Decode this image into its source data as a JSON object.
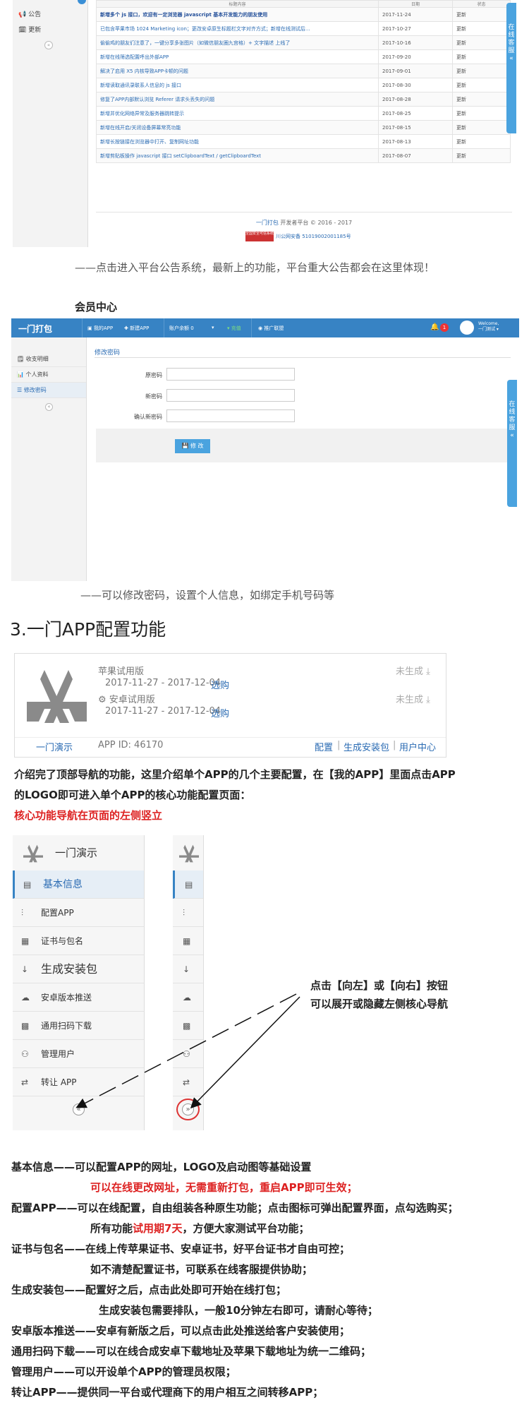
{
  "announce": {
    "sidebar": [
      "公告",
      "更新"
    ],
    "collapse": "«",
    "header_title": "标题内容",
    "header_date": "日期",
    "header_status": "状态",
    "rows": [
      {
        "title": "新增多个 js 接口，欢迎有一定浏览器 javascript 基本开发能力的朋友使用",
        "date": "2017-11-24",
        "status": "更新",
        "bold": true
      },
      {
        "title": "已包含苹果市场 1024 Marketing icon；更改安卓原生标题栏文字对齐方式；新增在线测试后...",
        "date": "2017-10-27",
        "status": "更新"
      },
      {
        "title": "偷偷鸡的朋友们注意了，一键分享多张图片（如微信朋友圈九宫格）+ 文字描述 上线了",
        "date": "2017-10-16",
        "status": "更新"
      },
      {
        "title": "新增在线筛选配置呼出外部APP",
        "date": "2017-09-20",
        "status": "更新"
      },
      {
        "title": "解决了启用 X5 内核导致APP卡顿的问题",
        "date": "2017-09-01",
        "status": "更新"
      },
      {
        "title": "新增读取通讯录联系人信息的 js 接口",
        "date": "2017-08-30",
        "status": "更新"
      },
      {
        "title": "修复了APP内部默认浏览 Referer 请求头丢失的问题",
        "date": "2017-08-28",
        "status": "更新"
      },
      {
        "title": "新增并优化网络异常及服务器跳转提示",
        "date": "2017-08-25",
        "status": "更新"
      },
      {
        "title": "新增在线开启/关闭设备屏幕常亮功能",
        "date": "2017-08-15",
        "status": "更新"
      },
      {
        "title": "新增长按链接在浏览器中打开、复制网址功能",
        "date": "2017-08-13",
        "status": "更新"
      },
      {
        "title": "新增剪贴板操作 javascript 接口 setClipboardText / getClipboardText",
        "date": "2017-08-07",
        "status": "更新"
      }
    ],
    "footer_brand": "一门打包",
    "footer_text": " 开发者平台 © 2016 - 2017",
    "footer_badge": "全国安全可信系统",
    "footer_icp": "川公网安备 51019002001185号",
    "kefu": "在线客服 «"
  },
  "caption1": "——点击进入平台公告系统，最新上的功能，平台重大公告都会在这里体现！",
  "member_title": "会员中心",
  "member": {
    "logo": "一门打包",
    "nav": [
      "我的APP",
      "新建APP",
      "账户余额 0",
      "▾",
      "充值",
      "推广联盟"
    ],
    "bell_count": "1",
    "welcome": "Welcome,",
    "username": "一门测试",
    "sidebar": [
      "收支明细",
      "个人资料",
      "修改密码"
    ],
    "crumb": "修改密码",
    "fields": [
      "原密码",
      "新密码",
      "确认新密码"
    ],
    "submit": "修 改",
    "kefu": "在线客服 «"
  },
  "caption2": "——可以修改密码，设置个人信息，如绑定手机号码等",
  "section_title": "3.一门APP配置功能",
  "app_card": {
    "ios_label": "苹果试用版",
    "ios_dates": "2017-11-27 - 2017-12-04",
    "ios_link": "选购",
    "ios_status": "未生成",
    "android_label": "安卓试用版",
    "android_dates": "2017-11-27 - 2017-12-04",
    "android_link": "选购",
    "android_status": "未生成",
    "app_name": "一门演示",
    "app_id": "APP ID: 46170",
    "links": [
      "配置",
      "生成安装包",
      "用户中心"
    ]
  },
  "intro_line1": "介绍完了顶部导航的功能，这里介绍单个APP的几个主要配置，在【我的APP】里面点击APP",
  "intro_line2": "的LOGO即可进入单个APP的核心功能配置页面：",
  "intro_red": "核心功能导航在页面的左侧竖立",
  "side_nav": {
    "app_name": "一门演示",
    "items": [
      "基本信息",
      "配置APP",
      "证书与包名",
      "生成安装包",
      "安卓版本推送",
      "通用扫码下载",
      "管理用户",
      "转让 APP"
    ],
    "collapse": "«",
    "expand": "»"
  },
  "note_line1": "点击【向左】或【向右】按钮",
  "note_line2": "可以展开或隐藏左侧核心导航",
  "desc": [
    {
      "parts": [
        [
          "基本信息——可以配置APP的网址，LOGO及启动图等基础设置",
          ""
        ]
      ]
    },
    {
      "indent": true,
      "parts": [
        [
          "可以在线更改网址，无需重新打包，重启APP即可生效；",
          "red"
        ]
      ]
    },
    {
      "parts": [
        [
          "配置APP——可以在线配置，自由组装各种原生功能；点击图标可弹出配置界面，点勾选购买；",
          ""
        ]
      ]
    },
    {
      "indent": true,
      "parts": [
        [
          "所有功能",
          ""
        ],
        [
          "试用期7天",
          "red"
        ],
        [
          "，方便大家测试平台功能；",
          ""
        ]
      ]
    },
    {
      "parts": [
        [
          "证书与包名——在线上传苹果证书、安卓证书，好平台证书才自由可控；",
          ""
        ]
      ]
    },
    {
      "indent": true,
      "parts": [
        [
          "如不清楚配置证书，可联系在线客服提供协助；",
          ""
        ]
      ]
    },
    {
      "parts": [
        [
          "生成安装包——配置好之后，点击此处即可开始在线打包；",
          ""
        ]
      ]
    },
    {
      "indent2": true,
      "parts": [
        [
          "生成安装包需要排队，一般10分钟左右即可，请耐心等待；",
          ""
        ]
      ]
    },
    {
      "parts": [
        [
          "安卓版本推送——安卓有新版之后，可以点击此处推送给客户安装使用；",
          ""
        ]
      ]
    },
    {
      "parts": [
        [
          "通用扫码下载——可以在线合成安卓下载地址及苹果下载地址为统一二维码；",
          ""
        ]
      ]
    },
    {
      "parts": [
        [
          "管理用户——可以开设单个APP的管理员权限；",
          ""
        ]
      ]
    },
    {
      "parts": [
        [
          "转让APP——提供同一平台或代理商下的用户相互之间转移APP；",
          ""
        ]
      ]
    }
  ]
}
